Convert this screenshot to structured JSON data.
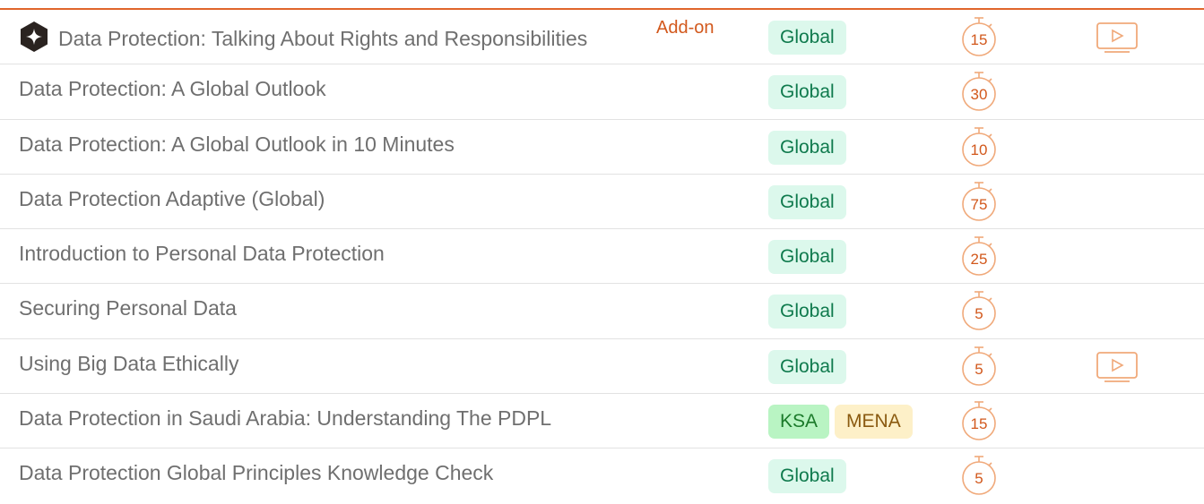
{
  "colors": {
    "accent": "#e0652b",
    "timer": "#f0a97a",
    "global_tag_bg": "#dcf8ec",
    "ksa_tag_bg": "#b9f4c3",
    "mena_tag_bg": "#fdf0c8"
  },
  "courses": [
    {
      "title": "Data Protection: Talking About Rights and Responsibilities",
      "addon": "Add-on",
      "tags": [
        "Global"
      ],
      "minutes": "15",
      "video": true
    },
    {
      "title": "Data Protection: A Global Outlook",
      "tags": [
        "Global"
      ],
      "minutes": "30",
      "video": false
    },
    {
      "title": "Data Protection: A Global Outlook in 10 Minutes",
      "tags": [
        "Global"
      ],
      "minutes": "10",
      "video": false
    },
    {
      "title": "Data Protection Adaptive (Global)",
      "tags": [
        "Global"
      ],
      "minutes": "75",
      "video": false
    },
    {
      "title": "Introduction to Personal Data Protection",
      "tags": [
        "Global"
      ],
      "minutes": "25",
      "video": false
    },
    {
      "title": "Securing Personal Data",
      "tags": [
        "Global"
      ],
      "minutes": "5",
      "video": false
    },
    {
      "title": "Using Big Data Ethically",
      "tags": [
        "Global"
      ],
      "minutes": "5",
      "video": true
    },
    {
      "title": "Data Protection in Saudi Arabia: Understanding The PDPL",
      "tags": [
        "KSA",
        "MENA"
      ],
      "minutes": "15",
      "video": false
    },
    {
      "title": "Data Protection Global Principles Knowledge Check",
      "tags": [
        "Global"
      ],
      "minutes": "5",
      "video": false
    }
  ]
}
